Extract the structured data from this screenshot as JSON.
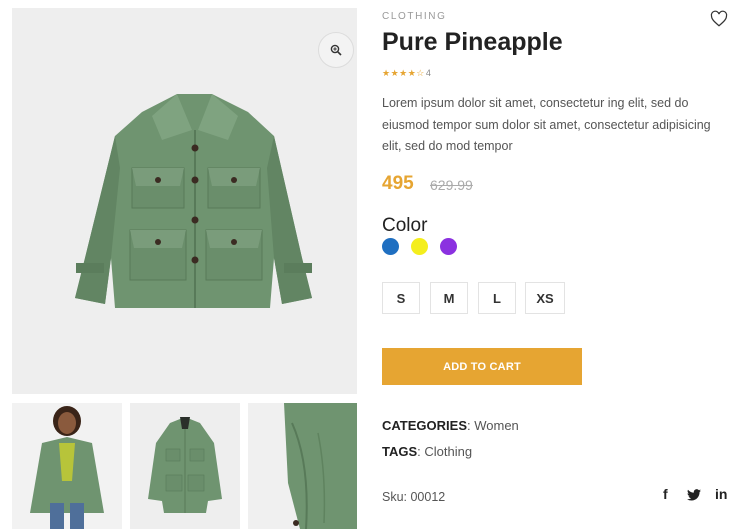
{
  "product": {
    "category": "CLOTHING",
    "title": "Pure Pineapple",
    "stars": "★★★★☆",
    "rating_count": "4",
    "description": "Lorem ipsum dolor sit amet, consectetur ing elit, sed do eiusmod tempor sum dolor sit amet, consectetur adipisicing elit, sed do mod tempor",
    "price": "495",
    "old_price": "629.99",
    "color_label": "Color",
    "colors": [
      "#1f6fc1",
      "#f4ee1d",
      "#8b31e0"
    ],
    "sizes": [
      "S",
      "M",
      "L",
      "XS"
    ],
    "add_to_cart": "ADD TO CART",
    "categories_label": "CATEGORIES",
    "categories_value": ": Women",
    "tags_label": "TAGS",
    "tags_value": ": Clothing",
    "sku": "Sku: 00012"
  },
  "social": {
    "facebook": "f",
    "linkedin": "in"
  },
  "icons": {
    "zoom": "zoom-in-icon",
    "wishlist": "heart-icon",
    "twitter": "twitter-icon"
  },
  "colors": {
    "accent": "#e6a532",
    "jacket": "#6f9470",
    "gallery_bg": "#eeeeee"
  }
}
